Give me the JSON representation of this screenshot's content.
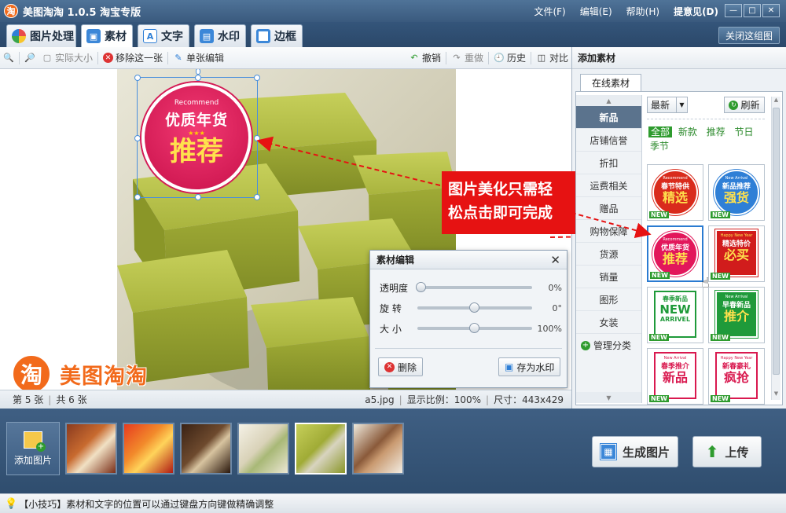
{
  "window": {
    "title": "美图淘淘 1.0.5 淘宝专版",
    "logo_char": "淘",
    "menu": [
      "文件(F)",
      "编辑(E)",
      "帮助(H)",
      "提意见(D)"
    ],
    "controls": [
      "—",
      "□",
      "✕"
    ]
  },
  "tabs": [
    {
      "label": "图片处理",
      "icon": "image-process-icon",
      "color": "#e15b5b"
    },
    {
      "label": "素材",
      "icon": "material-icon",
      "color": "#3b87d8"
    },
    {
      "label": "文字",
      "icon": "text-icon",
      "color": "#3b87d8"
    },
    {
      "label": "水印",
      "icon": "watermark-icon",
      "color": "#3b87d8"
    },
    {
      "label": "边框",
      "icon": "border-icon",
      "color": "#3b87d8"
    }
  ],
  "close_group": "关闭这组图",
  "toolbar": {
    "actual_size": "实际大小",
    "remove_one": "移除这一张",
    "single_edit": "单张编辑",
    "undo": "撤销",
    "redo": "重做",
    "history": "历史",
    "compare": "对比"
  },
  "sticker": {
    "small": "Recommend",
    "line1": "优质年货",
    "stars": "★★★",
    "line2": "推荐"
  },
  "callout": {
    "line1": "图片美化只需轻",
    "line2": "松点击即可完成"
  },
  "brand": {
    "char": "淘",
    "text": "美图淘淘"
  },
  "status": {
    "page": "第 5 张",
    "total": "共 6 张",
    "file": "a5.jpg",
    "ratio": "显示比例：100%",
    "size": "尺寸：443x429"
  },
  "dialog": {
    "title": "素材编辑",
    "sliders": [
      {
        "label": "透明度",
        "value": "0%",
        "pos": 0
      },
      {
        "label": "旋  转",
        "value": "0°",
        "pos": 0.5
      },
      {
        "label": "大  小",
        "value": "100%",
        "pos": 0.5
      }
    ],
    "delete": "删除",
    "save_watermark": "存为水印"
  },
  "right_panel": {
    "title": "添加素材",
    "tab": "在线素材",
    "sort": "最新",
    "refresh": "刷新",
    "categories": [
      "新品",
      "店铺信誉",
      "折扣",
      "运费相关",
      "赠品",
      "购物保障",
      "货源",
      "销量",
      "图形",
      "女装"
    ],
    "manage": "管理分类",
    "filters": [
      "全部",
      "新款",
      "推荐",
      "节日",
      "季节"
    ],
    "items": [
      {
        "top": "Recommend",
        "mid": "春节特供",
        "main": "精选",
        "new": "NEW",
        "color": "#d92b1c"
      },
      {
        "top": "New Arrival",
        "mid": "新品推荐",
        "main": "强货",
        "new": "NEW",
        "color": "#2f7fd6"
      },
      {
        "top": "Recommend",
        "mid": "优质年货",
        "main": "推荐",
        "new": "NEW",
        "color": "#e2175b"
      },
      {
        "top": "Happy New Year",
        "mid": "精选特价",
        "main": "必买",
        "new": "NEW",
        "color": "#d11c1c"
      },
      {
        "top": "春季新品",
        "mid": "NEW",
        "main": "ARRIVEL",
        "new": "NEW",
        "color": "#1f9a3a"
      },
      {
        "top": "New Arrival",
        "mid": "早春新品",
        "main": "推介",
        "new": "NEW",
        "color": "#1f9a3a"
      },
      {
        "top": "New Arrival",
        "mid": "春季推介",
        "main": "新品",
        "new": "NEW",
        "color": "#d9194f"
      },
      {
        "top": "Happy New Year",
        "mid": "新春豪礼",
        "main": "疯抢",
        "new": "NEW",
        "color": "#d9194f"
      }
    ]
  },
  "bottom": {
    "add_picture": "添加图片",
    "generate": "生成图片",
    "upload": "上传"
  },
  "tip": "【小技巧】素材和文字的位置可以通过键盘方向键做精确调整"
}
